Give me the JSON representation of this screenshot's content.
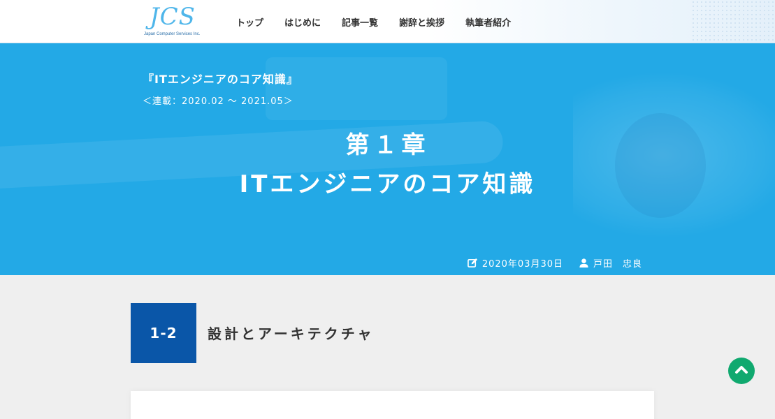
{
  "header": {
    "logo_text": "JCS",
    "logo_subtitle": "Japan Computer Services Inc.",
    "nav": [
      {
        "label": "トップ"
      },
      {
        "label": "はじめに"
      },
      {
        "label": "記事一覧"
      },
      {
        "label": "謝辞と挨拶"
      },
      {
        "label": "執筆者紹介"
      }
    ]
  },
  "hero": {
    "series_title": "『ITエンジニアのコア知識』",
    "series_period": "＜連載：2020.02 〜 2021.05＞",
    "chapter_label": "第１章",
    "chapter_title": "ITエンジニアのコア知識",
    "date": "2020年03月30日",
    "author": "戸田　忠良",
    "date_icon": "edit-icon",
    "author_icon": "user-icon"
  },
  "section": {
    "number": "1-2",
    "title": "設計とアーキテクチャ"
  },
  "back_to_top_icon": "chevron-up-icon",
  "colors": {
    "hero_bg": "#23a9e6",
    "section_number_bg": "#0a56a8",
    "back_to_top_bg": "#10a96f",
    "page_bg": "#efefef"
  }
}
